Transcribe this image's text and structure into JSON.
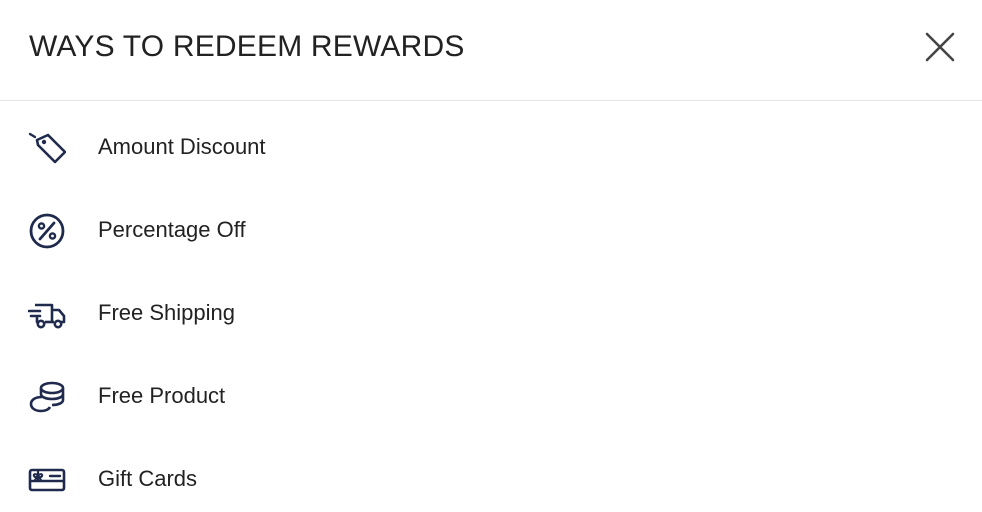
{
  "header": {
    "title": "WAYS TO REDEEM REWARDS"
  },
  "icons": {
    "close": "close-icon"
  },
  "colors": {
    "icon": "#1f2a4d",
    "text": "#222222",
    "divider": "#e3e3e3"
  },
  "items": [
    {
      "label": "Amount Discount",
      "icon": "tag-icon"
    },
    {
      "label": "Percentage Off",
      "icon": "percent-icon"
    },
    {
      "label": "Free Shipping",
      "icon": "truck-icon"
    },
    {
      "label": "Free Product",
      "icon": "coins-icon"
    },
    {
      "label": "Gift Cards",
      "icon": "gift-card-icon"
    }
  ]
}
